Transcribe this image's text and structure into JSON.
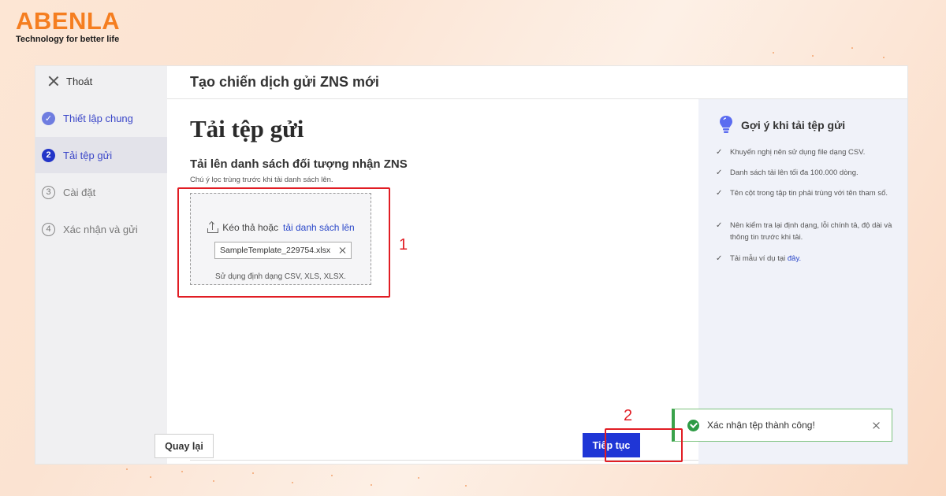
{
  "brand": {
    "name": "ABENLA",
    "tagline": "Technology for better life",
    "color": "#f57e20"
  },
  "sidebar": {
    "exit_label": "Thoát",
    "steps": [
      {
        "number": "✓",
        "label": "Thiết lập chung",
        "state": "done"
      },
      {
        "number": "2",
        "label": "Tải tệp gửi",
        "state": "active"
      },
      {
        "number": "3",
        "label": "Cài đặt",
        "state": "todo"
      },
      {
        "number": "4",
        "label": "Xác nhận và gửi",
        "state": "todo"
      }
    ]
  },
  "header": {
    "title": "Tạo chiến dịch gửi ZNS mới"
  },
  "main": {
    "page_title": "Tải tệp gửi",
    "section_title": "Tải lên danh sách đối tượng nhận ZNS",
    "hint": "Chú ý lọc trùng trước khi tải danh sách lên.",
    "dropzone": {
      "prompt": "Kéo thả hoặc",
      "link": "tải danh sách lên",
      "file_name": "SampleTemplate_229754.xlsx",
      "formats": "Sử dụng định dạng CSV, XLS, XLSX."
    },
    "back_label": "Quay lại",
    "next_label": "Tiếp tục"
  },
  "tips": {
    "title": "Gợi ý khi tải tệp gửi",
    "items": [
      "Khuyến nghị nên sử dụng file dạng CSV.",
      "Danh sách tải lên tối đa 100.000 dòng.",
      "Tên cột trong tập tin phải trùng với tên tham số.",
      "Nên kiểm tra lại định dạng, lỗi chính tả, độ dài và thông tin trước khi tải."
    ],
    "last_item_prefix": "Tải mẫu ví dụ tại",
    "last_item_link": "đây."
  },
  "toast": {
    "message": "Xác nhận tệp thành công!"
  },
  "annotations": {
    "label_1": "1",
    "label_2": "2",
    "color": "#e11d24"
  },
  "colors": {
    "primary": "#1f36d6",
    "success": "#2e9b45"
  }
}
